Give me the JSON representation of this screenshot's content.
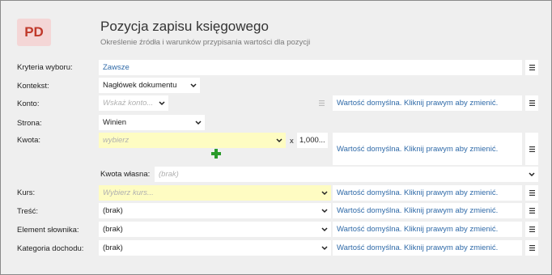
{
  "header": {
    "badge": "PD",
    "title": "Pozycja zapisu księgowego",
    "subtitle": "Określenie źródła i warunków przypisania wartości dla pozycji"
  },
  "fields": {
    "kryteria": {
      "label": "Kryteria wyboru:",
      "value": "Zawsze"
    },
    "kontekst": {
      "label": "Kontekst:",
      "value": "Nagłówek dokumentu"
    },
    "konto": {
      "label": "Konto:",
      "placeholder": "Wskaż konto...",
      "default_link": "Wartość domyślna. Kliknij prawym aby zmienić."
    },
    "strona": {
      "label": "Strona:",
      "value": "Winien"
    },
    "kwota": {
      "label": "Kwota:",
      "placeholder": "wybierz",
      "multiplier_sign": "x",
      "multiplier": "1,000...",
      "default_link": "Wartość domyślna. Kliknij prawym aby zmienić."
    },
    "kwota_wlasna": {
      "label": "Kwota własna:",
      "placeholder": "(brak)"
    },
    "kurs": {
      "label": "Kurs:",
      "placeholder": "Wybierz kurs...",
      "default_link": "Wartość domyślna. Kliknij prawym aby zmienić."
    },
    "tresc": {
      "label": "Treść:",
      "value": "(brak)",
      "default_link": "Wartość domyślna. Kliknij prawym aby zmienić."
    },
    "element_slownika": {
      "label": "Element słownika:",
      "value": "(brak)",
      "default_link": "Wartość domyślna. Kliknij prawym aby zmienić."
    },
    "kategoria_dochodu": {
      "label": "Kategoria dochodu:",
      "value": "(brak)",
      "default_link": "Wartość domyślna. Kliknij prawym aby zmienić."
    }
  },
  "icons": {
    "chevron": "chevron-down-icon",
    "menu": "hamburger-menu-icon",
    "add": "plus-icon"
  },
  "colors": {
    "badge_bg": "#f4d6d6",
    "badge_text": "#c0392b",
    "link": "#2f6aa8",
    "highlight": "#fefcc2",
    "add": "#2a9a2a"
  }
}
